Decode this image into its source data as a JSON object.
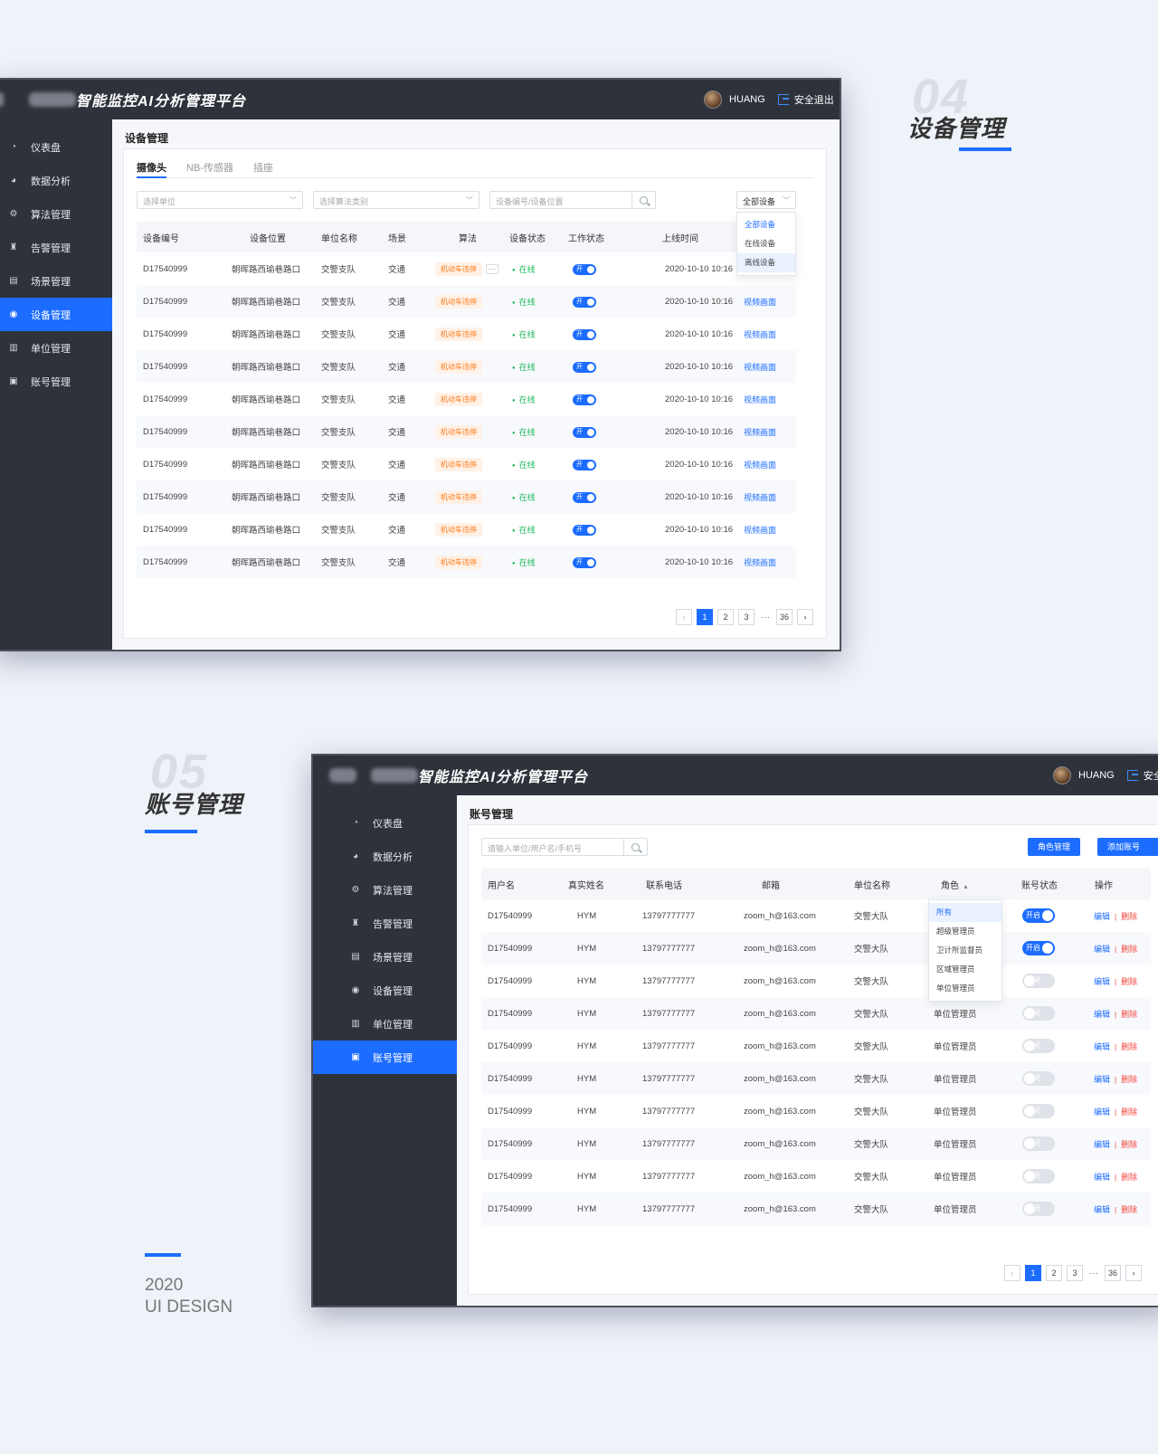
{
  "app_title": "智能监控AI分析管理平台",
  "user": {
    "name": "HUANG",
    "logout": "安全退出",
    "logout_short": "安全"
  },
  "sections": {
    "s04": {
      "ghost": "04",
      "title": "设备管理"
    },
    "s05": {
      "ghost": "05",
      "title": "账号管理"
    },
    "year": "2020",
    "design": "UI DESIGN"
  },
  "sidebar": {
    "items": [
      {
        "label": "仪表盘",
        "icon": "dashboard-icon"
      },
      {
        "label": "数据分析",
        "icon": "pie-chart-icon"
      },
      {
        "label": "算法管理",
        "icon": "algorithm-icon"
      },
      {
        "label": "告警管理",
        "icon": "alarm-icon"
      },
      {
        "label": "场景管理",
        "icon": "scene-icon"
      },
      {
        "label": "设备管理",
        "icon": "camera-icon"
      },
      {
        "label": "单位管理",
        "icon": "building-icon"
      },
      {
        "label": "账号管理",
        "icon": "account-icon"
      }
    ]
  },
  "device": {
    "page_title": "设备管理",
    "tabs": [
      "摄像头",
      "NB-传感器",
      "插座"
    ],
    "filters": {
      "unit_placeholder": "选择单位",
      "algo_placeholder": "选择算法类别",
      "search_placeholder": "设备编号/设备位置",
      "status_select": "全部设备"
    },
    "status_options": [
      "全部设备",
      "在线设备",
      "离线设备"
    ],
    "columns": [
      "设备编号",
      "设备位置",
      "单位名称",
      "场景",
      "算法",
      "设备状态",
      "工作状态",
      "上线时间"
    ],
    "rows": [
      {
        "id": "D17540999",
        "location": "朝晖路西瑜巷路口",
        "unit": "交警支队",
        "scene": "交通",
        "algo": "机动车违停",
        "more": "···",
        "status": "在线",
        "work": "开",
        "time": "2020-10-10 10:16",
        "action": ""
      },
      {
        "id": "D17540999",
        "location": "朝晖路西瑜巷路口",
        "unit": "交警支队",
        "scene": "交通",
        "algo": "机动车违停",
        "more": "",
        "status": "在线",
        "work": "开",
        "time": "2020-10-10 10:16",
        "action": "视频画面"
      },
      {
        "id": "D17540999",
        "location": "朝晖路西瑜巷路口",
        "unit": "交警支队",
        "scene": "交通",
        "algo": "机动车违停",
        "more": "",
        "status": "在线",
        "work": "开",
        "time": "2020-10-10 10:16",
        "action": "视频画面"
      },
      {
        "id": "D17540999",
        "location": "朝晖路西瑜巷路口",
        "unit": "交警支队",
        "scene": "交通",
        "algo": "机动车违停",
        "more": "",
        "status": "在线",
        "work": "开",
        "time": "2020-10-10 10:16",
        "action": "视频画面"
      },
      {
        "id": "D17540999",
        "location": "朝晖路西瑜巷路口",
        "unit": "交警支队",
        "scene": "交通",
        "algo": "机动车违停",
        "more": "",
        "status": "在线",
        "work": "开",
        "time": "2020-10-10 10:16",
        "action": "视频画面"
      },
      {
        "id": "D17540999",
        "location": "朝晖路西瑜巷路口",
        "unit": "交警支队",
        "scene": "交通",
        "algo": "机动车违停",
        "more": "",
        "status": "在线",
        "work": "开",
        "time": "2020-10-10 10:16",
        "action": "视频画面"
      },
      {
        "id": "D17540999",
        "location": "朝晖路西瑜巷路口",
        "unit": "交警支队",
        "scene": "交通",
        "algo": "机动车违停",
        "more": "",
        "status": "在线",
        "work": "开",
        "time": "2020-10-10 10:16",
        "action": "视频画面"
      },
      {
        "id": "D17540999",
        "location": "朝晖路西瑜巷路口",
        "unit": "交警支队",
        "scene": "交通",
        "algo": "机动车违停",
        "more": "",
        "status": "在线",
        "work": "开",
        "time": "2020-10-10 10:16",
        "action": "视频画面"
      },
      {
        "id": "D17540999",
        "location": "朝晖路西瑜巷路口",
        "unit": "交警支队",
        "scene": "交通",
        "algo": "机动车违停",
        "more": "",
        "status": "在线",
        "work": "开",
        "time": "2020-10-10 10:16",
        "action": "视频画面"
      },
      {
        "id": "D17540999",
        "location": "朝晖路西瑜巷路口",
        "unit": "交警支队",
        "scene": "交通",
        "algo": "机动车违停",
        "more": "",
        "status": "在线",
        "work": "开",
        "time": "2020-10-10 10:16",
        "action": "视频画面"
      }
    ],
    "pagination": {
      "pages": [
        "1",
        "2",
        "3"
      ],
      "ellipsis": "···",
      "last": "36",
      "current": "1"
    }
  },
  "account": {
    "page_title": "账号管理",
    "search_placeholder": "请输入单位/用户名/手机号",
    "buttons": {
      "roles": "角色管理",
      "add": "添加账号"
    },
    "columns": [
      "用户名",
      "真实姓名",
      "联系电话",
      "邮箱",
      "单位名称",
      "角色",
      "账号状态",
      "操作"
    ],
    "role_options": [
      "所有",
      "超级管理员",
      "卫计所监督员",
      "区域管理员",
      "单位管理员"
    ],
    "rows": [
      {
        "user": "D17540999",
        "name": "HYM",
        "phone": "13797777777",
        "email": "zoom_h@163.com",
        "unit": "交警大队",
        "role": "",
        "state": "开启",
        "on": true,
        "edit": "编辑",
        "del": "删除"
      },
      {
        "user": "D17540999",
        "name": "HYM",
        "phone": "13797777777",
        "email": "zoom_h@163.com",
        "unit": "交警大队",
        "role": "",
        "state": "开启",
        "on": true,
        "edit": "编辑",
        "del": "删除"
      },
      {
        "user": "D17540999",
        "name": "HYM",
        "phone": "13797777777",
        "email": "zoom_h@163.com",
        "unit": "交警大队",
        "role": "",
        "state": "关闭",
        "on": false,
        "edit": "编辑",
        "del": "删除"
      },
      {
        "user": "D17540999",
        "name": "HYM",
        "phone": "13797777777",
        "email": "zoom_h@163.com",
        "unit": "交警大队",
        "role": "单位管理员",
        "state": "关闭",
        "on": false,
        "edit": "编辑",
        "del": "删除"
      },
      {
        "user": "D17540999",
        "name": "HYM",
        "phone": "13797777777",
        "email": "zoom_h@163.com",
        "unit": "交警大队",
        "role": "单位管理员",
        "state": "关闭",
        "on": false,
        "edit": "编辑",
        "del": "删除"
      },
      {
        "user": "D17540999",
        "name": "HYM",
        "phone": "13797777777",
        "email": "zoom_h@163.com",
        "unit": "交警大队",
        "role": "单位管理员",
        "state": "关闭",
        "on": false,
        "edit": "编辑",
        "del": "删除"
      },
      {
        "user": "D17540999",
        "name": "HYM",
        "phone": "13797777777",
        "email": "zoom_h@163.com",
        "unit": "交警大队",
        "role": "单位管理员",
        "state": "关闭",
        "on": false,
        "edit": "编辑",
        "del": "删除"
      },
      {
        "user": "D17540999",
        "name": "HYM",
        "phone": "13797777777",
        "email": "zoom_h@163.com",
        "unit": "交警大队",
        "role": "单位管理员",
        "state": "关闭",
        "on": false,
        "edit": "编辑",
        "del": "删除"
      },
      {
        "user": "D17540999",
        "name": "HYM",
        "phone": "13797777777",
        "email": "zoom_h@163.com",
        "unit": "交警大队",
        "role": "单位管理员",
        "state": "关闭",
        "on": false,
        "edit": "编辑",
        "del": "删除"
      },
      {
        "user": "D17540999",
        "name": "HYM",
        "phone": "13797777777",
        "email": "zoom_h@163.com",
        "unit": "交警大队",
        "role": "单位管理员",
        "state": "关闭",
        "on": false,
        "edit": "编辑",
        "del": "删除"
      }
    ],
    "pagination": {
      "pages": [
        "1",
        "2",
        "3"
      ],
      "ellipsis": "···",
      "last": "36",
      "current": "1"
    }
  },
  "colors": {
    "accent": "#1c6cff",
    "sidebar": "#2e323b",
    "online": "#1cb85b",
    "danger": "#f5453d",
    "warning": "#ff7a1a",
    "page_bg": "#eef2f9"
  }
}
